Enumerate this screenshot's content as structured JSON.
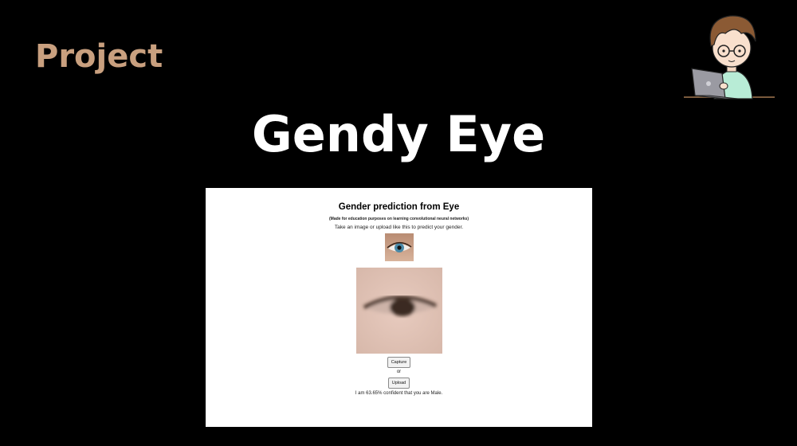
{
  "slide": {
    "label": "Project",
    "title": "Gendy Eye"
  },
  "avatar": {
    "icon": "developer-avatar-icon"
  },
  "app": {
    "title": "Gender prediction from Eye",
    "subtitle": "(Made for education purposes on learning convolutional neural networks)",
    "instructions": "Take an image or upload like this to predict your gender.",
    "capture_label": "Capture",
    "or_label": "or",
    "upload_label": "Upload",
    "result": "I am 63.65% confident that you are Male."
  },
  "colors": {
    "background": "#000000",
    "label": "#c9a07f",
    "title": "#ffffff",
    "panel": "#ffffff"
  }
}
